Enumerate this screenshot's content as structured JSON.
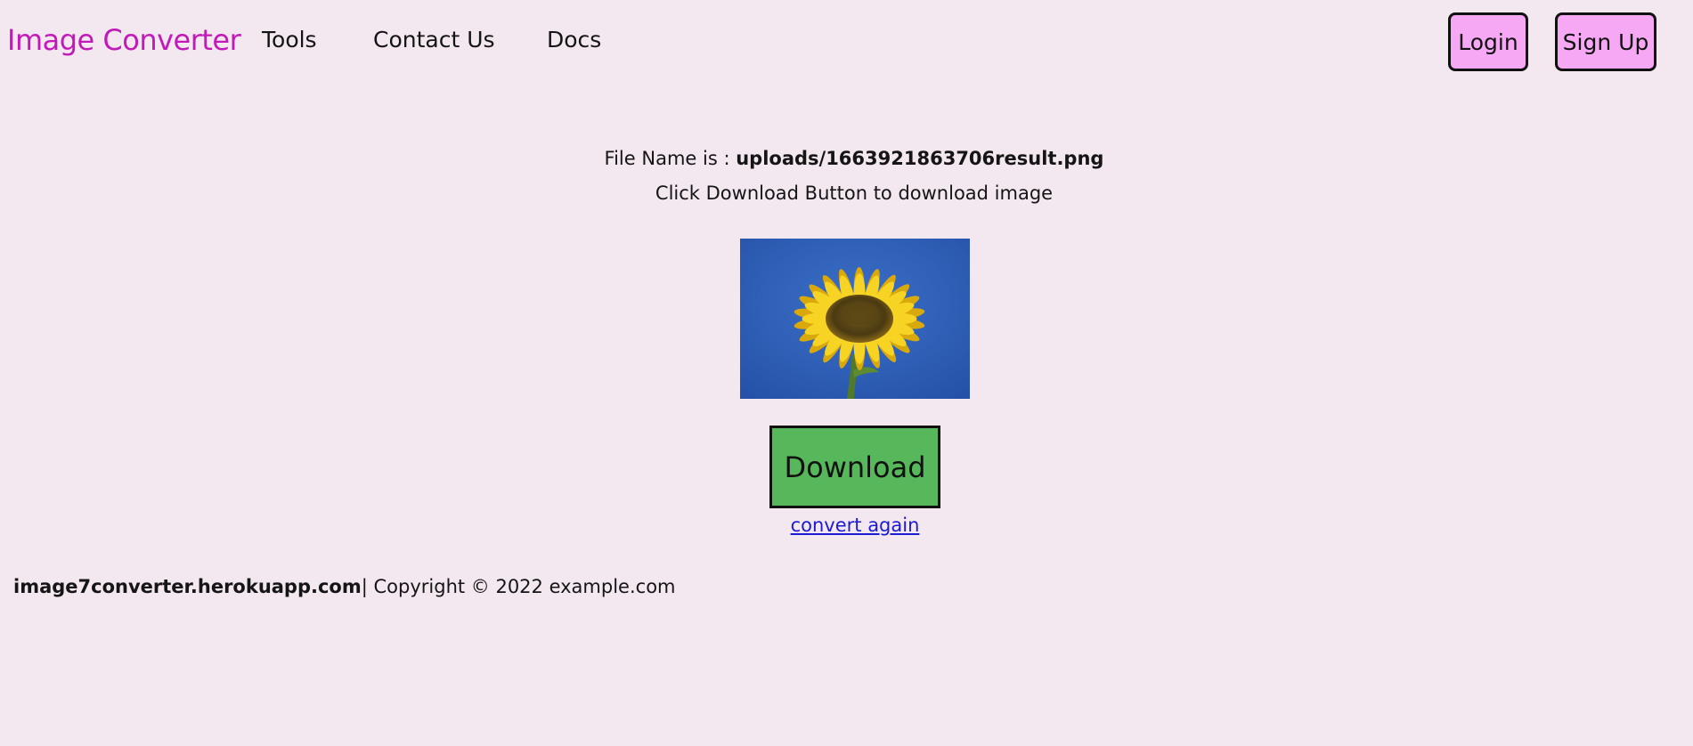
{
  "header": {
    "brand": "Image Converter",
    "nav": {
      "tools": "Tools",
      "contact": "Contact Us",
      "docs": "Docs"
    },
    "buttons": {
      "login": "Login",
      "signup": "Sign Up"
    }
  },
  "main": {
    "file_label": "File Name is :",
    "file_name": "uploads/1663921863706result.png",
    "hint": "Click Download Button to download image",
    "download_label": "Download",
    "convert_again": "convert again"
  },
  "footer": {
    "domain": "image7converter.herokuapp.com",
    "copyright": "| Copyright © 2022 example.com"
  },
  "colors": {
    "background": "#f3e7f0",
    "brand": "#c21ab8",
    "header_button": "#f7a8f4",
    "download_button": "#56b85a",
    "link": "#1b1bd6"
  }
}
